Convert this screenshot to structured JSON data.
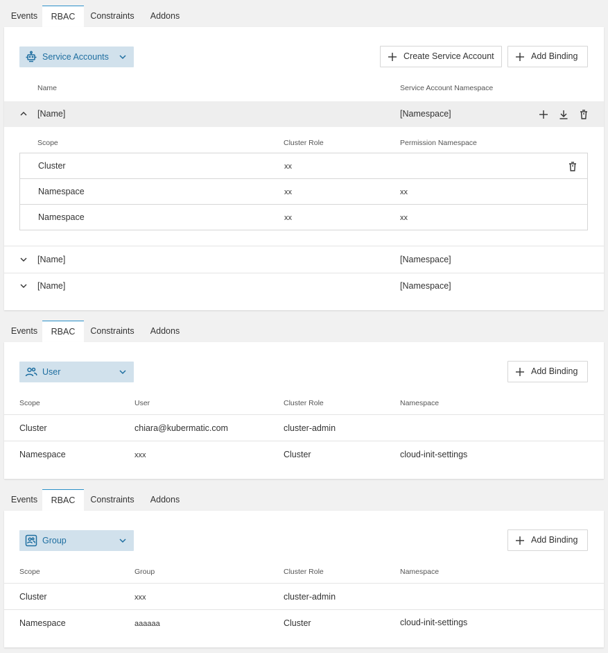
{
  "tabs": [
    "Events",
    "RBAC",
    "Constraints",
    "Addons"
  ],
  "colors": {
    "accent": "#2a8fc8",
    "selector_bg": "#d1e1ec",
    "selector_text": "#1e6ea0"
  },
  "section_service_accounts": {
    "selector_label": "Service Accounts",
    "create_button": "Create Service Account",
    "add_binding_button": "Add Binding",
    "col_name": "Name",
    "col_sa_namespace": "Service Account Namespace",
    "expanded_row": {
      "name": "[Name]",
      "namespace": "[Namespace]"
    },
    "sub_headers": {
      "scope": "Scope",
      "cluster_role": "Cluster Role",
      "permission_namespace": "Permission Namespace"
    },
    "sub_rows": [
      {
        "scope": "Cluster",
        "cluster_role": "xx",
        "namespace": ""
      },
      {
        "scope": "Namespace",
        "cluster_role": "xx",
        "namespace": "xx"
      },
      {
        "scope": "Namespace",
        "cluster_role": "xx",
        "namespace": "xx"
      }
    ],
    "collapsed_rows": [
      {
        "name": "[Name]",
        "namespace": "[Namespace]"
      },
      {
        "name": "[Name]",
        "namespace": "[Namespace]"
      }
    ]
  },
  "section_user": {
    "selector_label": "User",
    "add_binding_button": "Add Binding",
    "headers": {
      "scope": "Scope",
      "user": "User",
      "cluster_role": "Cluster Role",
      "namespace": "Namespace"
    },
    "rows": [
      {
        "scope": "Cluster",
        "user": "chiara@kubermatic.com",
        "cluster_role": "cluster-admin",
        "namespace": ""
      },
      {
        "scope": "Namespace",
        "user": "xxx",
        "cluster_role": "Cluster",
        "namespace": "cloud-init-settings"
      }
    ]
  },
  "section_group": {
    "selector_label": "Group",
    "add_binding_button": "Add Binding",
    "headers": {
      "scope": "Scope",
      "group": "Group",
      "cluster_role": "Cluster Role",
      "namespace": "Namespace"
    },
    "rows": [
      {
        "scope": "Cluster",
        "group": "xxx",
        "cluster_role": "cluster-admin",
        "namespace": ""
      },
      {
        "scope": "Namespace",
        "group": "aaaaaa",
        "cluster_role": "Cluster",
        "namespace": "cloud-init-settings"
      }
    ]
  }
}
